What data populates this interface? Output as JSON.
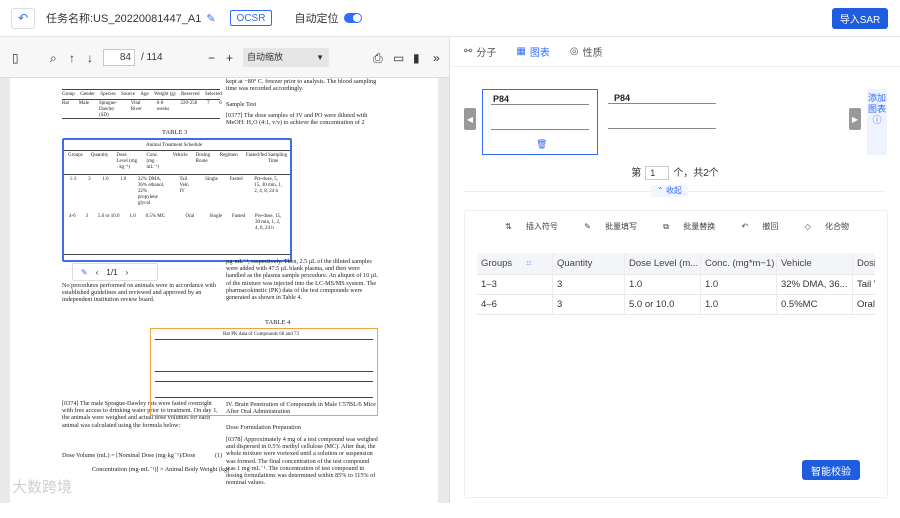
{
  "topbar": {
    "back_icon": "back-arrow-icon",
    "task_name": "任务名称:US_20220081447_A1",
    "ocsr_label": "OCSR",
    "auto_position_label": "自动定位",
    "auto_position_on": true,
    "import_button": "导入SAR",
    "accent": "#1f5de0"
  },
  "pdf_toolbar": {
    "current_page": "84",
    "total_pages": "/ 114",
    "zoom": "自动缩放"
  },
  "pdf_content": {
    "table_headers": [
      "Group",
      "Gender",
      "Species",
      "Source",
      "Age",
      "Weight (g)",
      "Reserved",
      "Selected"
    ],
    "table_row": [
      "Rat",
      "Male",
      "Sprague-Dawley (SD)",
      "Vital River",
      "6-8 weeks",
      "220-250",
      "7",
      "6"
    ],
    "table3_title": "TABLE 3",
    "table3_subtitle": "Animal Treatment Schedule",
    "table3_headers": [
      "Groups",
      "Quantity",
      "Dose Level (mg · kg⁻¹)",
      "Conc. (mg · mL⁻¹)",
      "Vehicle",
      "Dosing Route",
      "Regimen",
      "Fasted/fed",
      "Sampling Time"
    ],
    "table3_rows": [
      [
        "1-3",
        "3",
        "1.0",
        "1.0",
        "32% DMA, 36% ethanol, 32% propylene glycol",
        "Tail Vein IV",
        "Single",
        "Fasted",
        "Pre-dose, 5, 15, 30 min, 1, 2, 4, 8, 24 h"
      ],
      [
        "4-6",
        "3",
        "5.0 or 10.0",
        "1.0",
        "0.5% MC",
        "Oral",
        "Single",
        "Fasted",
        "Pre-dose, 15, 30 min, 1, 2, 4, 8, 24 h"
      ]
    ],
    "mini_page": "1/1",
    "table4_title": "TABLE 4",
    "table4_subtitle": "Rat PK data of Compounds 60 and 73",
    "right_para1": "kept at −80° C. freezer prior to analysis. The blood sampling time was recorded accordingly.",
    "sample_test": "Sample Test",
    "para_0377": "[0377]   The dose samples of IV and PO were diluted with MeOH: H₂O (4:1, v/v) to achieve the concentration of 2",
    "para_right_mid": "μg·mL⁻¹, respectively. Then, 2.5 μL of the diluted samples were added with 47.5 μL blank plasma, and then were handled as the plasma sample procedure. An aliquot of 10 μL of the mixture was injected into the LC-MS/MS system. The pharmacokinetic (PK) data of the test compounds were generated as shown in Table 4.",
    "para_left_mid": "No procedures performed on animals were in accordance with established guidelines and reviewed and approved by an independent institution review board.",
    "para_0374": "[0374]   The male Sprague-Dawley rats were fasted overnight with free access to drinking water prior to treatment. On day 1, the animals were weighed and actual dose volumes for each animal was calculated using the formula below:",
    "formula1": "Dose Volume (mL) = [Nominal Dose (mg·kg⁻¹)/Dose",
    "formula1_num": "(1)",
    "formula2": "Concentration (mg·mL⁻¹)] × Animal Body Weight (kg)",
    "section_iv": "IV. Brain Penetration of Compounds in Male C57BL/6 Mice After Oral Administration",
    "dose_prep": "Dose Formulation Preparation",
    "para_0378": "[0378]   Approximately 4 mg of a test compound was weighed and dispersed in 0.5% methyl cellulose (MC). After that, the whole mixture were vortexed until a solution or suspension was formed. The final concentration of the test compound was 1 mg·mL⁻¹. The concentration of test compound in dosing formulations was determined within 85% to 115% of nominal values.",
    "watermark": "大数跨境"
  },
  "right_tabs": [
    {
      "label": "分子",
      "icon": "molecule-icon",
      "active": false
    },
    {
      "label": "图表",
      "icon": "table-icon",
      "active": true
    },
    {
      "label": "性质",
      "icon": "property-icon",
      "active": false
    }
  ],
  "thumbnails": [
    {
      "label": "P84",
      "selected": true
    },
    {
      "label": "P84",
      "selected": false
    }
  ],
  "side_add": "添加图表",
  "pager": {
    "prefix": "第",
    "value": "1",
    "suffix": "个，共2个"
  },
  "collapse_label": "收起",
  "table_tools": [
    {
      "label": "插入符号",
      "icon": "insert-symbol-icon"
    },
    {
      "label": "批量填写",
      "icon": "batch-fill-icon"
    },
    {
      "label": "批量替换",
      "icon": "batch-replace-icon"
    },
    {
      "label": "撤回",
      "icon": "undo-icon"
    },
    {
      "label": "化合物",
      "icon": "compound-icon"
    }
  ],
  "grid": {
    "headers": [
      "Groups",
      "Quantity",
      "Dose Level (m...",
      "Conc. (mg*m−1)",
      "Vehicle",
      "Dosin"
    ],
    "rows": [
      [
        "1–3",
        "3",
        "1.0",
        "1.0",
        "32% DMA, 36...",
        "Tail V"
      ],
      [
        "4–6",
        "3",
        "5.0 or 10.0",
        "1.0",
        "0.5%MC",
        "Oral"
      ]
    ]
  },
  "smart_check_button": "智能校验"
}
